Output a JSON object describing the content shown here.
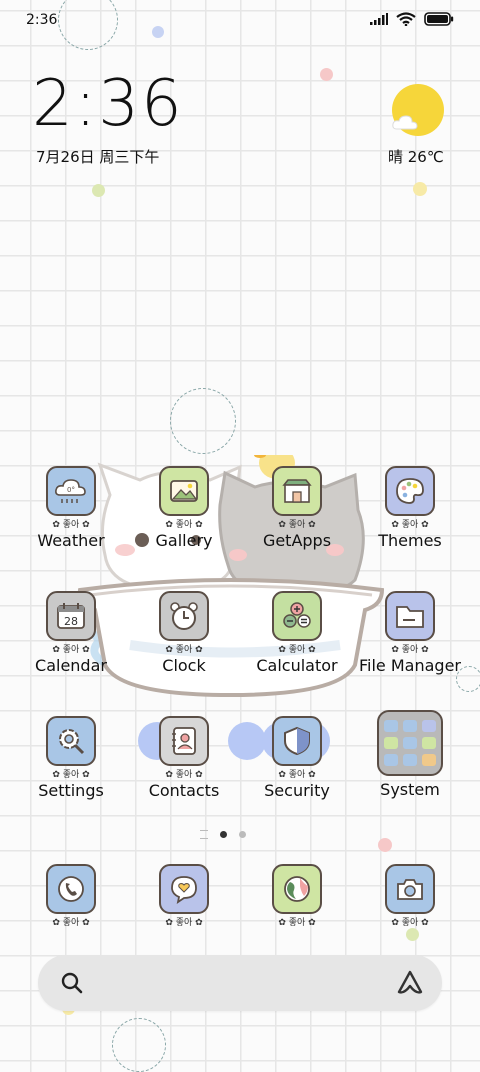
{
  "status_bar": {
    "time": "2:36"
  },
  "clock_widget": {
    "time": "2:36",
    "date": "7月26日 周三下午"
  },
  "weather_widget": {
    "text": "晴 26℃"
  },
  "icon_tag": "✿ 좋아 ✿",
  "weather_icon_text": "0°",
  "calendar_icon_text": "28",
  "apps": [
    {
      "label": "Weather",
      "icon": "weather-cloud-icon"
    },
    {
      "label": "Gallery",
      "icon": "gallery-icon"
    },
    {
      "label": "GetApps",
      "icon": "store-icon"
    },
    {
      "label": "Themes",
      "icon": "palette-icon"
    },
    {
      "label": "Calendar",
      "icon": "calendar-icon"
    },
    {
      "label": "Clock",
      "icon": "alarm-clock-icon"
    },
    {
      "label": "Calculator",
      "icon": "calculator-icon"
    },
    {
      "label": "File Manager",
      "icon": "folder-icon"
    },
    {
      "label": "Settings",
      "icon": "gear-icon"
    },
    {
      "label": "Contacts",
      "icon": "contacts-book-icon"
    },
    {
      "label": "Security",
      "icon": "shield-icon"
    },
    {
      "label": "System",
      "icon": "folder-grid-icon"
    }
  ],
  "dock": [
    {
      "icon": "phone-icon"
    },
    {
      "icon": "message-heart-icon"
    },
    {
      "icon": "browser-globe-icon"
    },
    {
      "icon": "camera-icon"
    }
  ],
  "page_indicator": {
    "pages": 2,
    "current": 1
  },
  "colors": {
    "sun": "#f6d63a",
    "icon_blue": "#a9c6e6",
    "icon_green": "#cfe5a3",
    "icon_purple": "#b9c3ea",
    "outline": "#5a4e46"
  }
}
